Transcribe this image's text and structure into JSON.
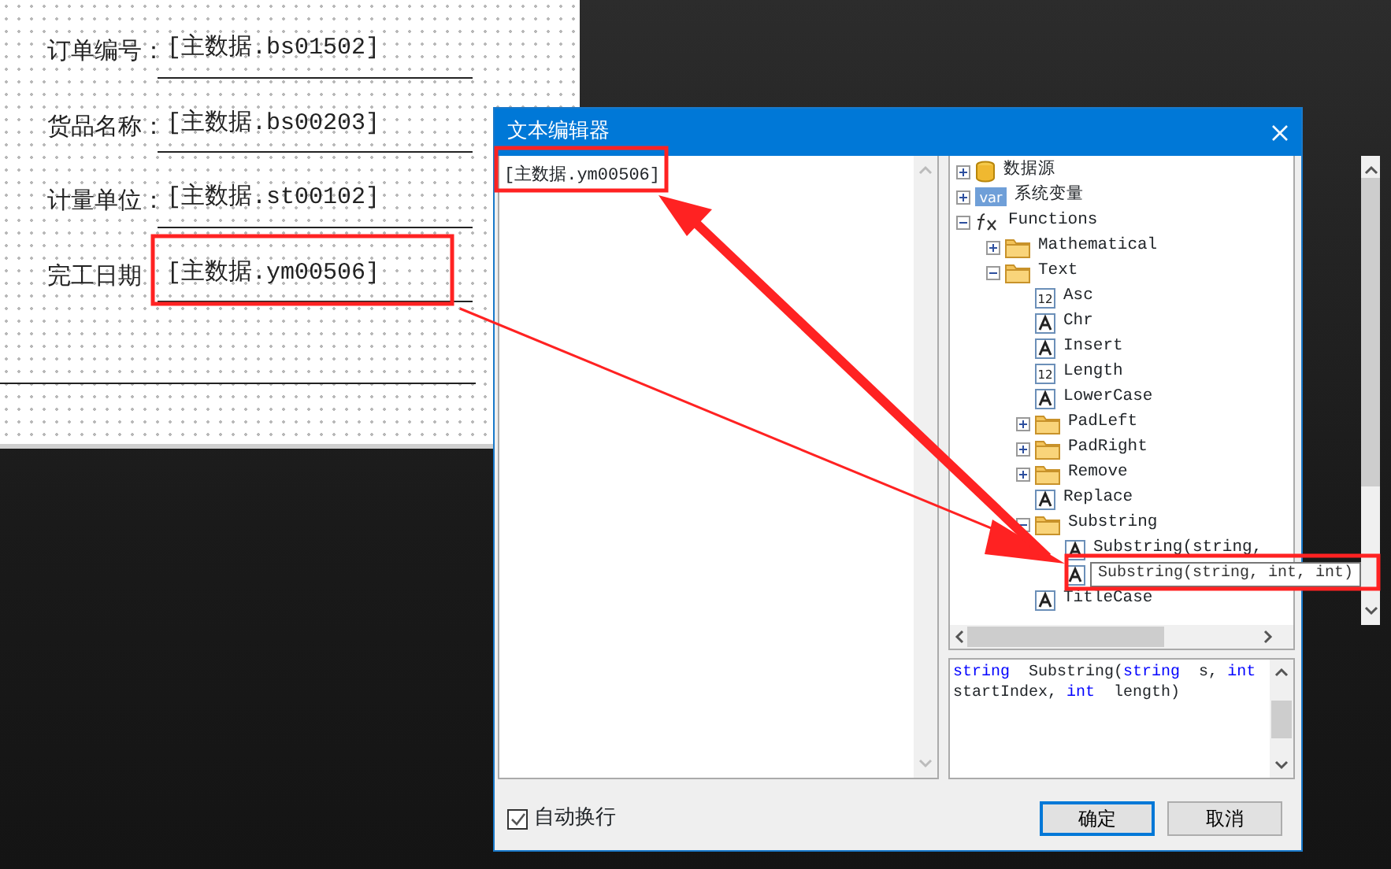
{
  "canvas": {
    "fields": [
      {
        "label": "订单编号：",
        "value": "[主数据.bs01502]"
      },
      {
        "label": "货品名称：",
        "value": "[主数据.bs00203]"
      },
      {
        "label": "计量单位：",
        "value": "[主数据.st00102]"
      },
      {
        "label": "完工日期",
        "value": "[主数据.ym00506]"
      }
    ]
  },
  "dialog": {
    "title": "文本编辑器",
    "editor": {
      "value": "[主数据.ym00506]"
    },
    "tree": [
      {
        "label": "数据源",
        "kind": "database",
        "expanded": false,
        "selected": false
      },
      {
        "label": "系统变量",
        "kind": "variable",
        "icon_text": "var",
        "expanded": false,
        "selected": false
      },
      {
        "label": "Functions",
        "kind": "function",
        "expanded": true,
        "selected": false,
        "children": [
          {
            "label": "Mathematical",
            "kind": "folder",
            "expanded": false,
            "selected": false
          },
          {
            "label": "Text",
            "kind": "folder",
            "expanded": true,
            "selected": false,
            "children": [
              {
                "label": "Asc",
                "kind": "number",
                "icon_text": "12",
                "selected": false
              },
              {
                "label": "Chr",
                "kind": "text",
                "selected": false
              },
              {
                "label": "Insert",
                "kind": "text",
                "selected": false
              },
              {
                "label": "Length",
                "kind": "number",
                "icon_text": "12",
                "selected": false
              },
              {
                "label": "LowerCase",
                "kind": "text",
                "selected": false
              },
              {
                "label": "PadLeft",
                "kind": "folder",
                "expanded": false,
                "selected": false
              },
              {
                "label": "PadRight",
                "kind": "folder",
                "expanded": false,
                "selected": false
              },
              {
                "label": "Remove",
                "kind": "folder",
                "expanded": false,
                "selected": false
              },
              {
                "label": "Replace",
                "kind": "text",
                "selected": false
              },
              {
                "label": "Substring",
                "kind": "folder",
                "expanded": true,
                "selected": false,
                "children": [
                  {
                    "label": "Substring(string,",
                    "kind": "text",
                    "selected": false
                  },
                  {
                    "label": "Substring(string, int, int)",
                    "kind": "text",
                    "selected": true
                  }
                ]
              },
              {
                "label": "TitleCase",
                "kind": "text",
                "selected": false
              }
            ]
          }
        ]
      }
    ],
    "description": {
      "tokens": [
        {
          "text": "string",
          "kind": "keyword"
        },
        {
          "text": "  Substring(",
          "kind": "plain"
        },
        {
          "text": "string",
          "kind": "keyword"
        },
        {
          "text": "  s, ",
          "kind": "plain"
        },
        {
          "text": "int",
          "kind": "keyword"
        },
        {
          "text": " startIndex, ",
          "kind": "plain"
        },
        {
          "text": "int",
          "kind": "keyword"
        },
        {
          "text": "  length)",
          "kind": "plain"
        }
      ]
    },
    "checkbox": {
      "label": "自动换行",
      "checked": true
    },
    "buttons": [
      {
        "label": "确定",
        "default": true
      },
      {
        "label": "取消",
        "default": false
      }
    ]
  }
}
